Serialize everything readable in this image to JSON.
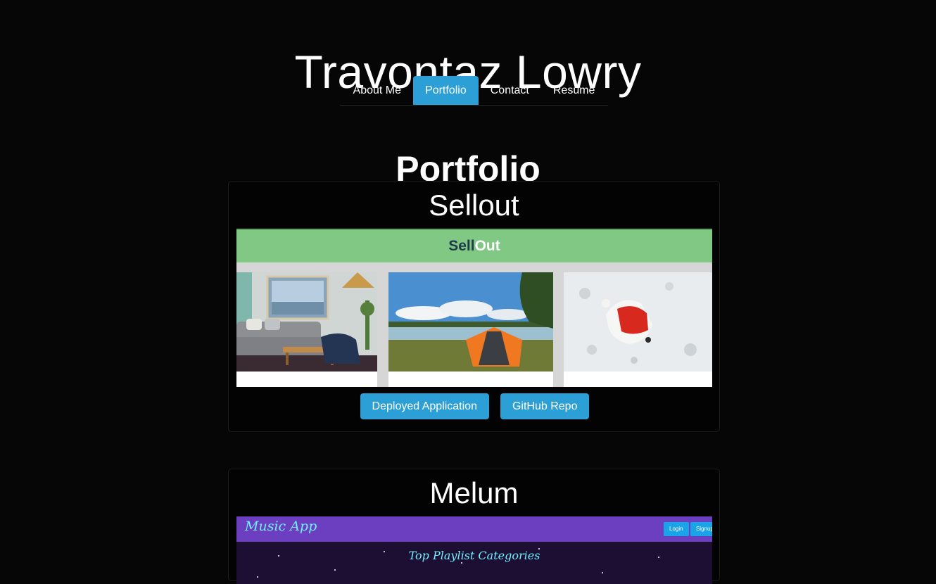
{
  "header": {
    "site_title": "Travontaz Lowry",
    "nav": [
      {
        "label": "About Me",
        "active": false
      },
      {
        "label": "Portfolio",
        "active": true
      },
      {
        "label": "Contact",
        "active": false
      },
      {
        "label": "Resume",
        "active": false
      }
    ]
  },
  "main": {
    "heading": "Portfolio",
    "projects": [
      {
        "title": "Sellout",
        "screenshot": {
          "brand_part1": "Sell",
          "brand_part2": "Out",
          "photos": [
            "living-room-photo",
            "camping-tent-photo",
            "dog-in-snow-photo"
          ]
        },
        "buttons": {
          "deployed": "Deployed Application",
          "repo": "GitHub Repo"
        }
      },
      {
        "title": "Melum",
        "screenshot": {
          "logo": "Music App",
          "login": "Login",
          "signup": "Signup",
          "heading": "Top Playlist Categories"
        }
      }
    ]
  },
  "colors": {
    "background": "#060606",
    "accent": "#2b9fd6",
    "sellout_bar": "#80c884",
    "melum_bar": "#6b3fbf"
  }
}
